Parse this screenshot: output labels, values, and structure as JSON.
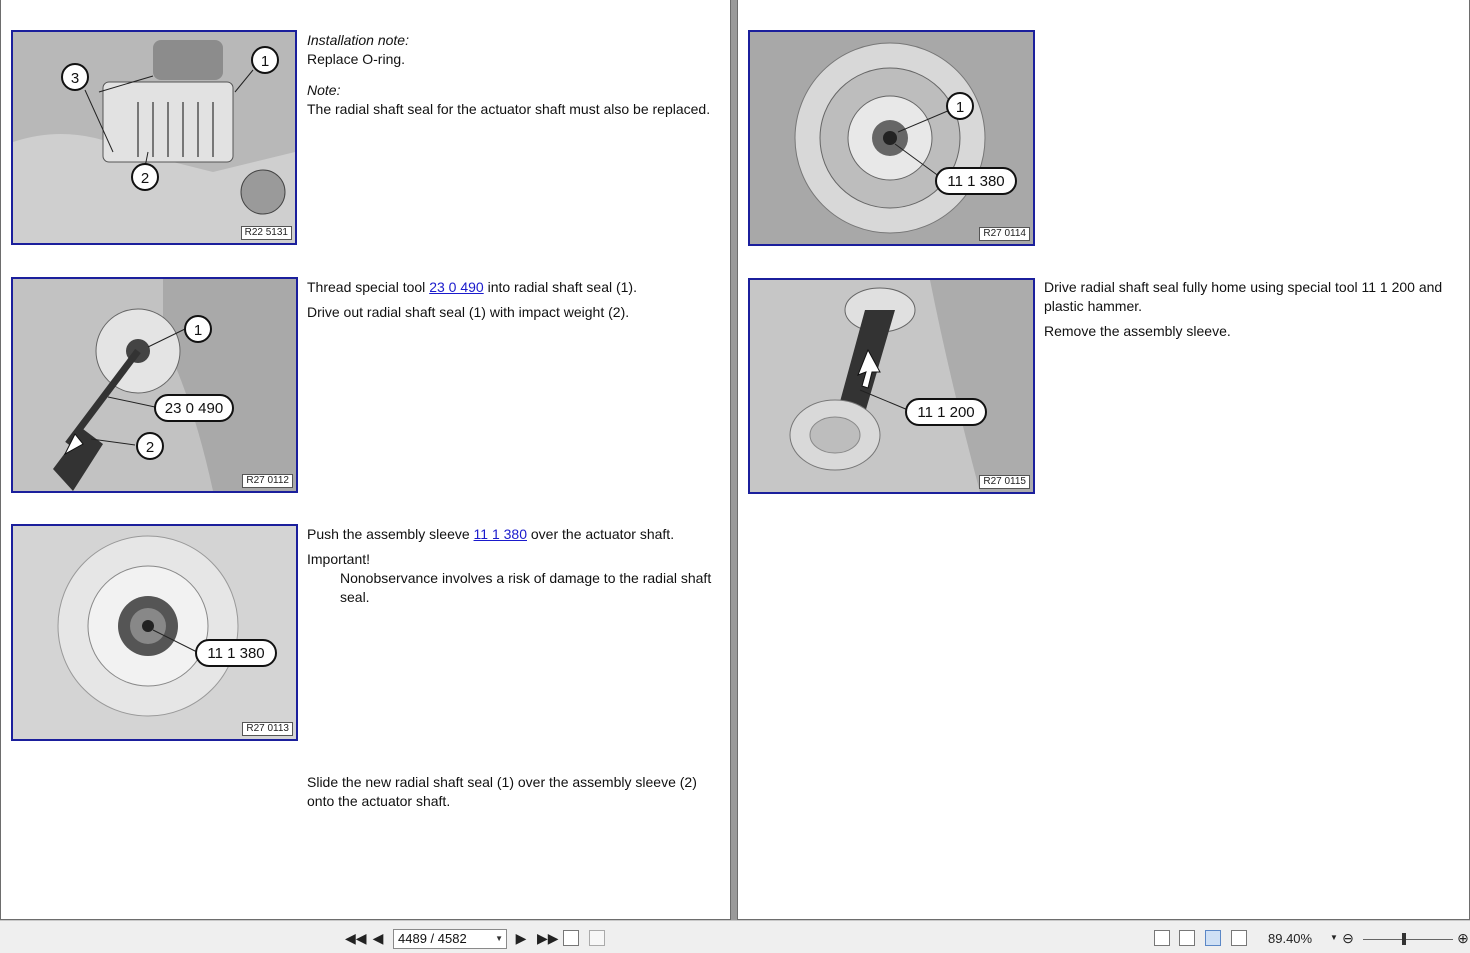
{
  "left_page": {
    "step1": {
      "fig_ref": "R22 5131",
      "callouts": [
        "1",
        "2",
        "3"
      ],
      "install_note_title": "Installation note:",
      "install_note_text": "Replace O-ring.",
      "note_title": "Note:",
      "note_text": "The radial shaft seal for the actuator shaft must also be replaced."
    },
    "step2": {
      "fig_ref": "R27 0112",
      "callouts": [
        "1",
        "23 0 490",
        "2"
      ],
      "line1_pre": "Thread special tool ",
      "line1_link": "23 0 490",
      "line1_post": " into radial shaft seal (1).",
      "line2": "Drive out radial shaft seal (1) with impact weight (2)."
    },
    "step3": {
      "fig_ref": "R27 0113",
      "callouts": [
        "11 1 380"
      ],
      "line1_pre": "Push the assembly sleeve ",
      "line1_link": "11 1 380",
      "line1_post": " over the actuator shaft.",
      "important_title": "Important!",
      "important_text": "Nonobservance involves a risk of damage to the radial shaft seal."
    },
    "step4": {
      "text": "Slide the new radial shaft seal (1) over the assembly sleeve (2) onto the actuator shaft."
    }
  },
  "right_page": {
    "step5": {
      "fig_ref": "R27 0114",
      "callouts": [
        "1",
        "11 1 380"
      ]
    },
    "step6": {
      "fig_ref": "R27 0115",
      "callouts": [
        "11 1 200"
      ],
      "line1": "Drive radial shaft seal fully home using special tool 11 1 200 and plastic hammer.",
      "line2": "Remove the assembly sleeve."
    }
  },
  "toolbar": {
    "page_indicator": "4489 / 4582",
    "zoom": "89.40%"
  },
  "colors": {
    "figure_border": "#1b1f9c",
    "link": "#1a1acc",
    "viewer_bg": "#9a9a9a"
  }
}
